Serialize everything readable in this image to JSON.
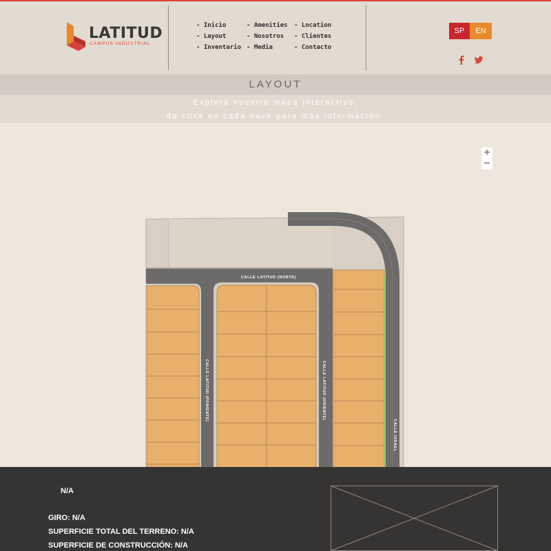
{
  "header": {
    "logo_text": "LATITUD",
    "logo_sub": "CAMPUS INDUSTRIAL",
    "nav": [
      "- Inicio",
      "- Amenities",
      "- Location",
      "- Layout",
      "- Nosotros",
      "- Clientes",
      "- Inventario",
      "- Media",
      "- Contacto"
    ],
    "lang_sp": "SP",
    "lang_en": "EN",
    "social": [
      "facebook-icon",
      "twitter-icon"
    ]
  },
  "layout": {
    "title": "LAYOUT",
    "subtitle_line1": "Explora nuestro mapa interactivo,",
    "subtitle_line2": "da click en cada nave para más información."
  },
  "map": {
    "zoom_in": "+",
    "zoom_out": "−",
    "streets": {
      "norte": "CALLE LATITUD (NORTE)",
      "poniente": "CALLE LATITUD (PONIENTE)",
      "oriente": "CALLE LATITUD (ORIENTE)",
      "israel": "CALLE ISRAEL"
    }
  },
  "footer": {
    "name": "N/A",
    "giro": "GIRO: N/A",
    "terreno": "SUPERFICIE TOTAL DEL TERRENO: N/A",
    "construccion": "SUPERFICIE DE CONSTRUCCIÓN: N/A"
  },
  "colors": {
    "brand_red": "#d9423a",
    "brand_orange": "#e8892c",
    "lot": "#e8b06b",
    "road": "#6d6b69",
    "footer_bg": "#363432"
  }
}
